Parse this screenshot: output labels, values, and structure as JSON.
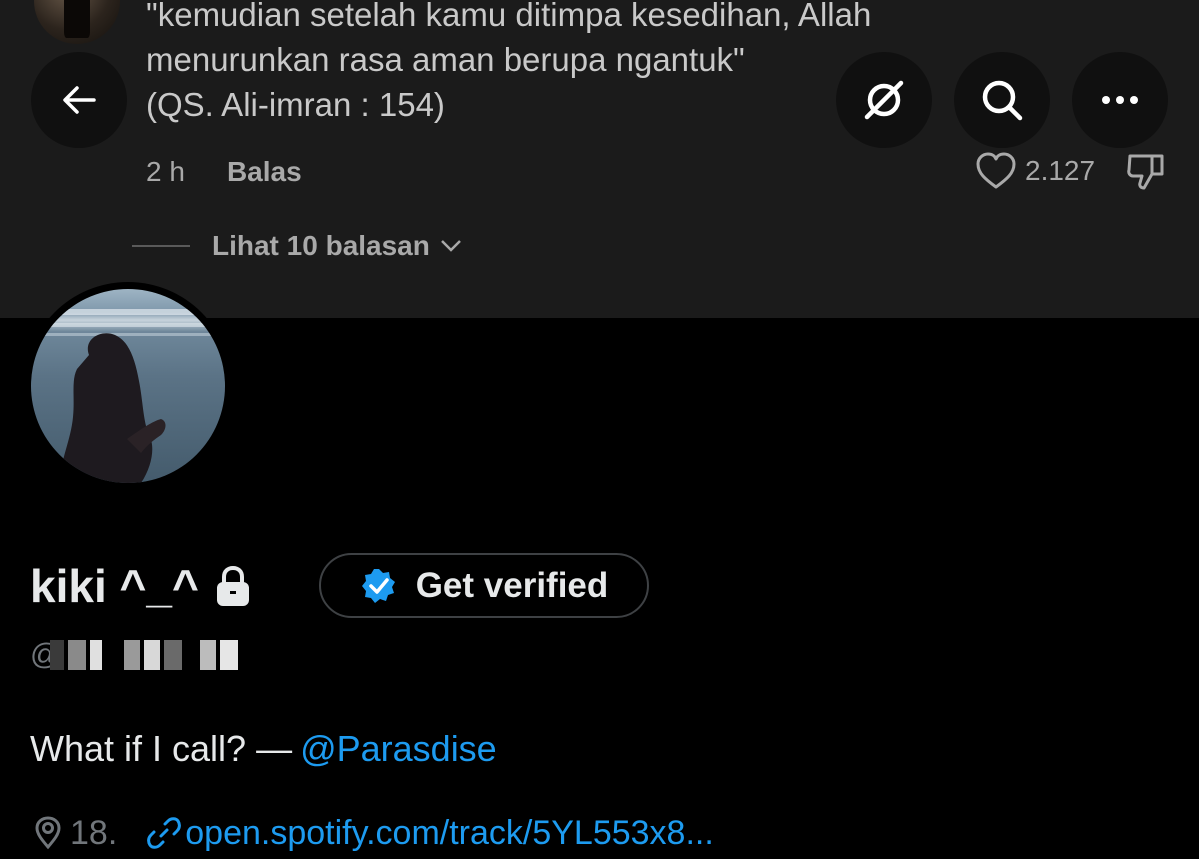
{
  "comment": {
    "text": "\"kemudian setelah kamu ditimpa kesedihan, Allah\nmenurunkan rasa aman berupa ngantuk\"\n(QS. Ali-imran : 154)",
    "time": "2 h",
    "reply_label": "Balas",
    "like_count": "2.127",
    "view_replies": "Lihat 10 balasan"
  },
  "profile": {
    "display_name": "kiki ^_^",
    "get_verified_label": "Get verified",
    "handle_prefix": "@",
    "bio_text": "What if I call? —",
    "bio_mention": "@Parasdise",
    "location": "18.",
    "link": "open.spotify.com/track/5YL553x8..."
  },
  "icons": {
    "back": "arrow-left-icon",
    "grok": "grok-icon",
    "search": "search-icon",
    "more": "more-icon",
    "heart": "heart-icon",
    "dislike": "dislike-icon",
    "chevron": "chevron-down-icon",
    "lock": "lock-icon",
    "verified": "verified-badge-icon",
    "location": "location-pin-icon",
    "link": "link-icon"
  },
  "colors": {
    "accent": "#1d9bf0",
    "background": "#000000",
    "banner": "#1b1b1b",
    "muted_text": "#71767b"
  }
}
